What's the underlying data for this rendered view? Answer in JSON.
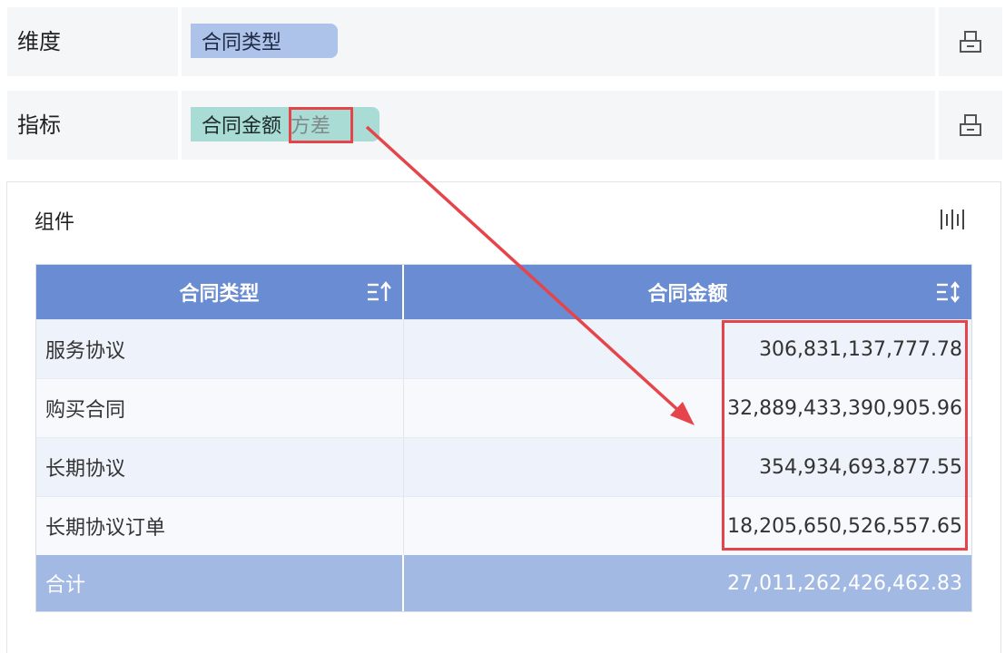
{
  "dimension": {
    "label": "维度",
    "field": "合同类型"
  },
  "indicator": {
    "label": "指标",
    "field": "合同金额",
    "aggregation": "方差"
  },
  "panel": {
    "title": "组件"
  },
  "table": {
    "columns": [
      "合同类型",
      "合同金额"
    ],
    "rows": [
      {
        "type": "服务协议",
        "amount": "306,831,137,777.78"
      },
      {
        "type": "购买合同",
        "amount": "32,889,433,390,905.96"
      },
      {
        "type": "长期协议",
        "amount": "354,934,693,877.55"
      },
      {
        "type": "长期协议订单",
        "amount": "18,205,650,526,557.65"
      }
    ],
    "total": {
      "label": "合计",
      "amount": "27,011,262,426,462.83"
    }
  },
  "colors": {
    "header_bg": "#6a8cd3",
    "footer_bg": "#a2b9e3",
    "dim_pill": "#aec3ea",
    "ind_pill": "#a8dcd4",
    "highlight": "#e5454a"
  },
  "icons": {
    "row_action": "lock-shape-icon",
    "panel_tool": "bar-columns-icon",
    "sort_asc": "sort-ascending-icon",
    "sort_both": "sort-both-icon"
  }
}
